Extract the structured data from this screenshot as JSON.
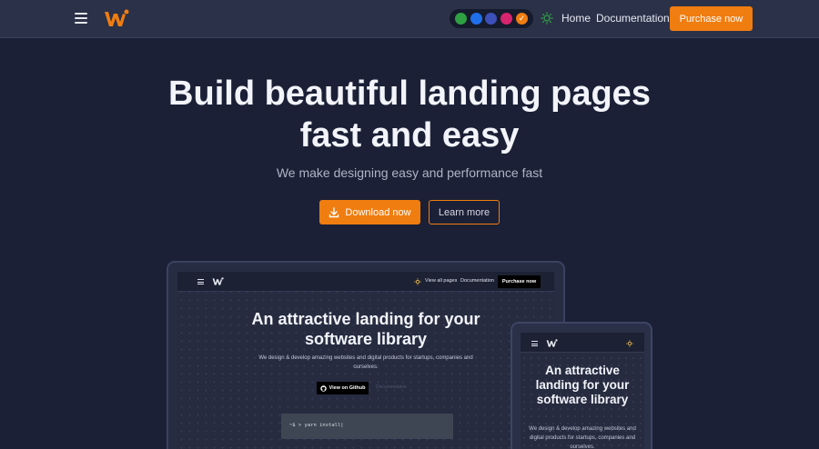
{
  "colors": {
    "background": "#1b2036",
    "navbar": "#2b3148",
    "accent": "#f07d10",
    "swatches": [
      "#2ea043",
      "#1f6feb",
      "#3d4fb8",
      "#d6246e",
      "#f07d10"
    ]
  },
  "navbar": {
    "menu_icon": "hamburger-menu-icon",
    "logo_icon": "brand-w-logo",
    "theme_icon": "sun-icon",
    "home_label": "Home",
    "docs_label": "Documentation",
    "purchase_label": "Purchase now",
    "selected_swatch_icon": "check-icon"
  },
  "hero": {
    "title": "Build beautiful landing pages fast and easy",
    "subtitle": "We make designing easy and performance fast",
    "download_label": "Download now",
    "download_icon": "download-icon",
    "learn_label": "Learn more"
  },
  "laptop_preview": {
    "nav_view_all": "View all pages",
    "nav_docs": "Documentation",
    "nav_purchase": "Purchase now",
    "title": "An attractive landing for your software library",
    "subtitle": "We design & develop amazing websites and digital products for startups, companies and ourselves.",
    "github_label": "View on Github",
    "github_icon": "github-icon",
    "ghost_label": "Documentation",
    "terminal_text": "~$ > yarn install|"
  },
  "phone_preview": {
    "title": "An attractive landing for your software library",
    "subtitle": "We design & develop amazing websites and digital products for startups, companies and ourselves."
  }
}
